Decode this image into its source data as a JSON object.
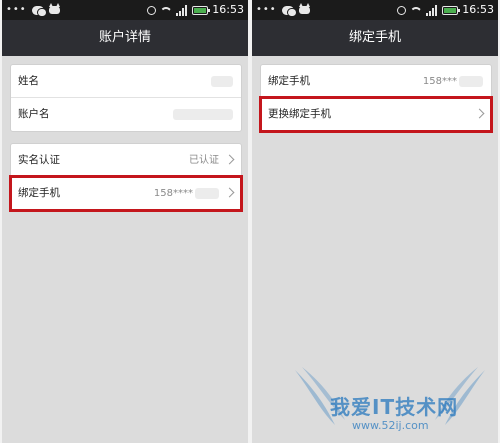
{
  "colors": {
    "title_bar": "#2d2e33",
    "status_bar": "#1b1b1b",
    "background": "#dcdcdc",
    "highlight": "#c4161c",
    "watermark": "#2878be"
  },
  "left_screen": {
    "status": {
      "dots": "•••",
      "time": "16:53",
      "icons": [
        "chat-icon",
        "cat-icon",
        "alarm-icon",
        "wifi-icon",
        "signal-icon",
        "battery-icon"
      ]
    },
    "title": "账户详情",
    "group1": [
      {
        "label": "姓名"
      },
      {
        "label": "账户名"
      }
    ],
    "group2": [
      {
        "label": "实名认证",
        "value": "已认证"
      },
      {
        "label": "绑定手机",
        "value": "158****"
      }
    ]
  },
  "right_screen": {
    "status": {
      "dots": "•••",
      "time": "16:53",
      "icons": [
        "chat-icon",
        "cat-icon",
        "alarm-icon",
        "wifi-icon",
        "signal-icon",
        "battery-icon"
      ]
    },
    "title": "绑定手机",
    "group1": [
      {
        "label": "绑定手机",
        "value": "158***"
      },
      {
        "label": "更换绑定手机"
      }
    ]
  },
  "watermark": {
    "text": "我爱IT技术网",
    "url": "www.52ij.com"
  }
}
